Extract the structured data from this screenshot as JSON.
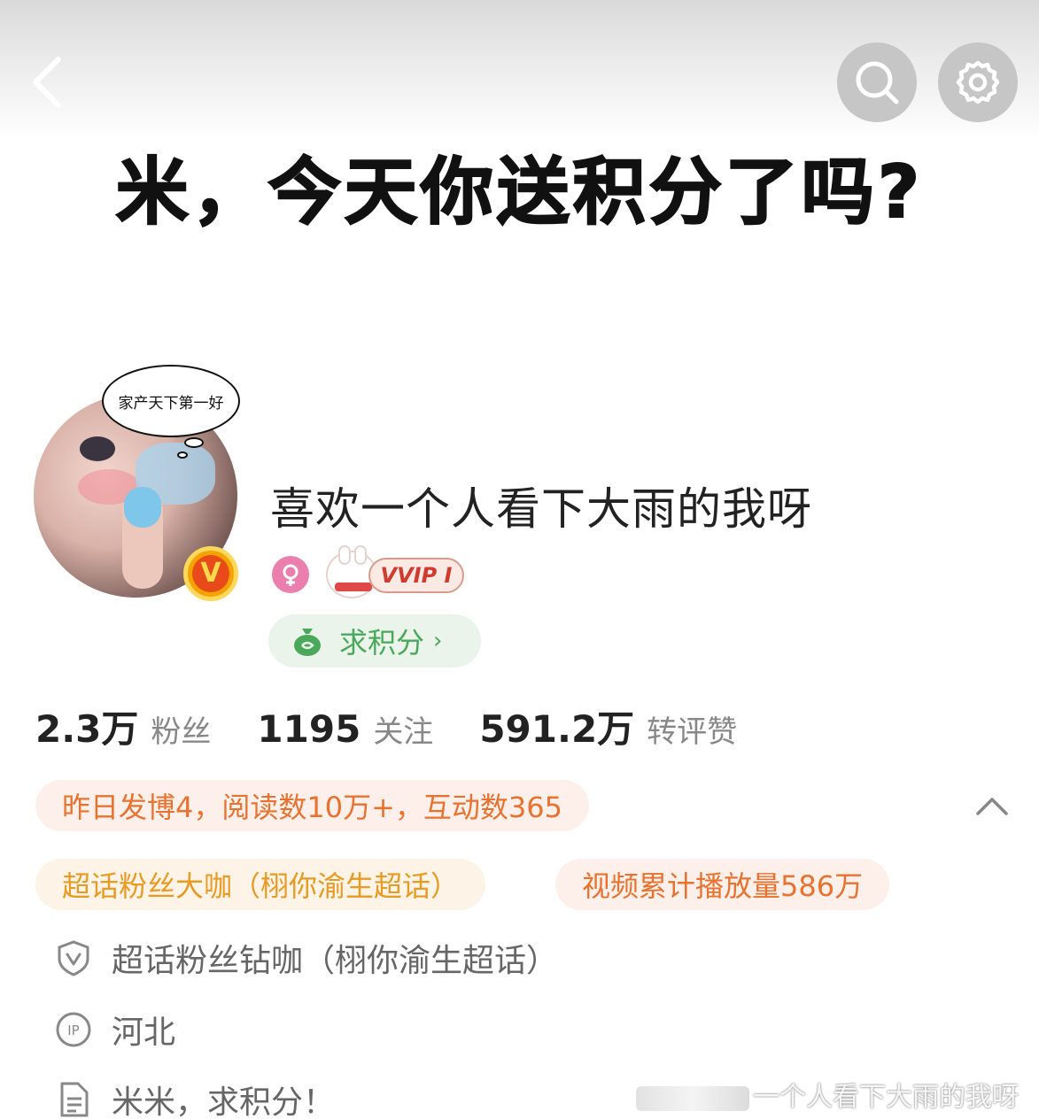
{
  "header": {
    "banner_title": "米，今天你送积分了吗?"
  },
  "profile": {
    "thought_bubble": "家产天下第一好",
    "verified_badge": "V",
    "username": "喜欢一个人看下大雨的我呀",
    "vvip_label": "VVIP I",
    "points_button_label": "求积分",
    "points_button_chevron": "›"
  },
  "stats": [
    {
      "value": "2.3万",
      "label": "粉丝"
    },
    {
      "value": "1195",
      "label": "关注"
    },
    {
      "value": "591.2万",
      "label": "转评赞"
    }
  ],
  "tags": {
    "yesterday": "昨日发博4，阅读数10万+，互动数365",
    "super_fan": "超话粉丝大咖（栩你渝生超话）",
    "video_plays": "视频累计播放量586万"
  },
  "info": {
    "diamond_fan": "超话粉丝钻咖（栩你渝生超话）",
    "ip_location": "河北",
    "bio": "米米，求积分！"
  },
  "watermark": {
    "text": "一个人看下大雨的我呀"
  },
  "colors": {
    "accent_orange": "#e8722f",
    "accent_gold": "#e89a23",
    "accent_green": "#4aa85a",
    "female_pink": "#ea7fae"
  },
  "icons": [
    "back-arrow-icon",
    "search-icon",
    "gear-icon",
    "female-icon",
    "money-bag-icon",
    "chevron-up-icon",
    "shield-v-icon",
    "ip-icon",
    "document-icon"
  ]
}
